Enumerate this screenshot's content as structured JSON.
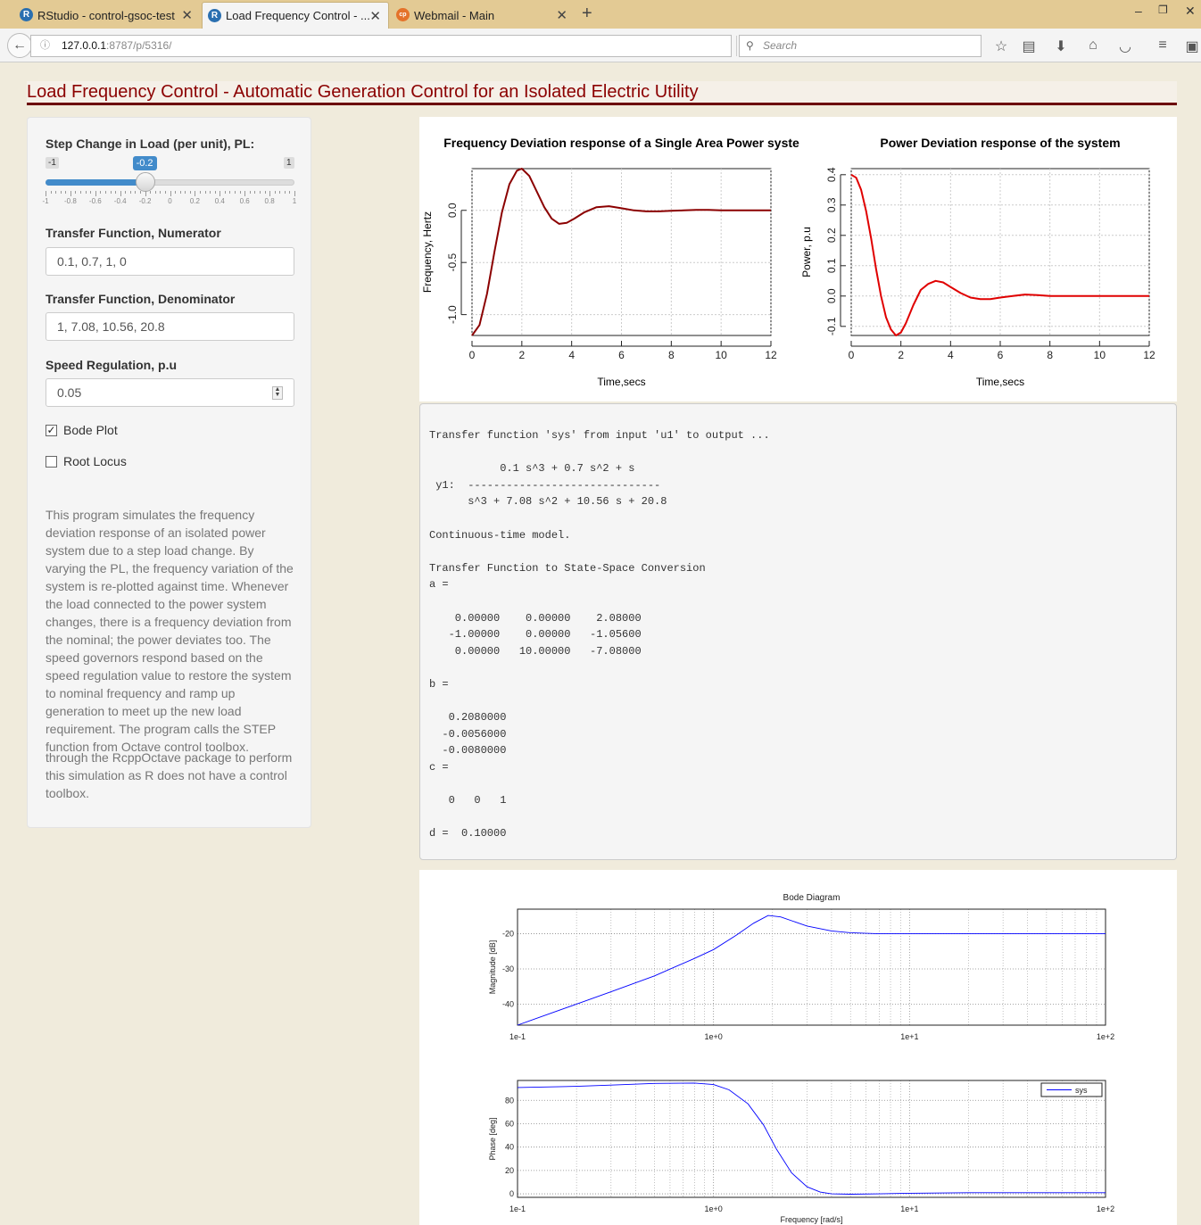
{
  "browser": {
    "tabs": [
      {
        "label": "RStudio - control-gsoc-test",
        "icon": "R",
        "active": false
      },
      {
        "label": "Load Frequency Control - ...",
        "icon": "R",
        "active": true
      },
      {
        "label": "Webmail - Main",
        "icon": "cp",
        "active": false
      }
    ],
    "new_tab_symbol": "+",
    "url_host": "127.0.0.1",
    "url_path": ":8787/p/5316/",
    "search_placeholder": "Search"
  },
  "page_title": "Load Frequency Control - Automatic Generation Control for an Isolated Electric Utility",
  "sidebar": {
    "slider": {
      "label": "Step Change in Load (per unit), PL:",
      "min_label": "-1",
      "max_label": "1",
      "value_label": "-0.2",
      "value": -0.2,
      "min": -1,
      "max": 1,
      "ticks": [
        "-1",
        "-0.8",
        "-0.6",
        "-0.4",
        "-0.2",
        "0",
        "0.2",
        "0.4",
        "0.6",
        "0.8",
        "1"
      ]
    },
    "numerator": {
      "label": "Transfer Function, Numerator",
      "value": "0.1, 0.7, 1, 0"
    },
    "denominator": {
      "label": "Transfer Function, Denominator",
      "value": "1, 7.08, 10.56, 20.8"
    },
    "speed_reg": {
      "label": "Speed Regulation, p.u",
      "value": "0.05"
    },
    "bode": {
      "label": "Bode Plot",
      "checked": true,
      "check_mark": "✓"
    },
    "rlocus": {
      "label": "Root Locus",
      "checked": false
    },
    "description_1": "This program simulates the frequency deviation response of an isolated power system due to a step load change. By varying the PL, the frequency variation of the system is re-plotted against time. Whenever the load connected to the power system changes, there is a frequency deviation from the nominal; the power deviates too. The speed governors respond based on the speed regulation value to restore the system to nominal frequency and ramp up generation to meet up the new load requirement. The program calls the STEP function from Octave control toolbox.",
    "description_2": "through the RcppOctave package to perform this simulation as R does not have a control toolbox."
  },
  "chart_data": [
    {
      "type": "line",
      "title": "Frequency Deviation response of a Single Area Power syste",
      "xlabel": "Time,secs",
      "ylabel": "Frequency, Hertz",
      "xlim": [
        0,
        12
      ],
      "ylim": [
        -1.2,
        0.4
      ],
      "xticks": [
        "0",
        "2",
        "4",
        "6",
        "8",
        "10",
        "12"
      ],
      "yticks": [
        "-1.0",
        "-0.5",
        "0.0"
      ],
      "ytick_values": [
        -1.0,
        -0.5,
        0.0
      ],
      "color": "#8b0000",
      "x": [
        0,
        0.3,
        0.6,
        0.9,
        1.2,
        1.5,
        1.8,
        2.0,
        2.3,
        2.6,
        2.9,
        3.2,
        3.5,
        3.8,
        4.1,
        4.5,
        5.0,
        5.5,
        6.0,
        6.5,
        7.0,
        7.5,
        8.0,
        8.5,
        9.0,
        9.5,
        10.0,
        10.5,
        11.0,
        11.5,
        12.0
      ],
      "y": [
        -1.2,
        -1.1,
        -0.8,
        -0.4,
        -0.02,
        0.25,
        0.38,
        0.4,
        0.33,
        0.18,
        0.03,
        -0.08,
        -0.13,
        -0.12,
        -0.08,
        -0.02,
        0.03,
        0.04,
        0.02,
        0.0,
        -0.01,
        -0.01,
        -0.005,
        0.0,
        0.005,
        0.005,
        0.0,
        0.0,
        0.0,
        0.0,
        0.0
      ],
      "grid": true
    },
    {
      "type": "line",
      "title": "Power Deviation response of the system",
      "xlabel": "Time,secs",
      "ylabel": "Power, p.u",
      "xlim": [
        0,
        12
      ],
      "ylim": [
        -0.13,
        0.42
      ],
      "xticks": [
        "0",
        "2",
        "4",
        "6",
        "8",
        "10",
        "12"
      ],
      "yticks": [
        "-0.1",
        "0.0",
        "0.1",
        "0.2",
        "0.3",
        "0.4"
      ],
      "ytick_values": [
        -0.1,
        0.0,
        0.1,
        0.2,
        0.3,
        0.4
      ],
      "color": "#e00000",
      "x": [
        0,
        0.2,
        0.4,
        0.6,
        0.8,
        1.0,
        1.2,
        1.4,
        1.6,
        1.8,
        2.0,
        2.2,
        2.5,
        2.8,
        3.1,
        3.4,
        3.7,
        4.0,
        4.4,
        4.8,
        5.2,
        5.6,
        6.0,
        6.5,
        7.0,
        7.5,
        8.0,
        9.0,
        10.0,
        11.0,
        12.0
      ],
      "y": [
        0.4,
        0.39,
        0.35,
        0.28,
        0.19,
        0.09,
        0.0,
        -0.07,
        -0.11,
        -0.13,
        -0.12,
        -0.09,
        -0.03,
        0.02,
        0.04,
        0.05,
        0.045,
        0.03,
        0.01,
        -0.005,
        -0.01,
        -0.01,
        -0.005,
        0.0,
        0.005,
        0.003,
        0.0,
        0.0,
        0.0,
        0.0,
        0.0
      ],
      "grid": true
    },
    {
      "type": "line",
      "title": "Bode Diagram",
      "xlabel": "",
      "ylabel": "Magnitude [dB]",
      "xscale": "log",
      "xlim": [
        0.1,
        100
      ],
      "ylim": [
        -46,
        -13
      ],
      "xticks": [
        "1e-1",
        "1e+0",
        "1e+1",
        "1e+2"
      ],
      "yticks": [
        "-20",
        "-30",
        "-40"
      ],
      "ytick_values": [
        -20,
        -30,
        -40
      ],
      "color": "#0000ff",
      "x": [
        0.1,
        0.2,
        0.3,
        0.5,
        0.8,
        1.0,
        1.3,
        1.6,
        1.9,
        2.2,
        2.6,
        3.0,
        4.0,
        5.0,
        7.0,
        10,
        20,
        50,
        100
      ],
      "y": [
        -46,
        -40,
        -36.5,
        -32,
        -27,
        -24.5,
        -20.5,
        -17,
        -14.8,
        -15.2,
        -16.6,
        -17.8,
        -19.2,
        -19.7,
        -20.0,
        -20.0,
        -20.0,
        -20.0,
        -20.0
      ],
      "grid": true
    },
    {
      "type": "line",
      "title": "",
      "xlabel": "Frequency [rad/s]",
      "ylabel": "Phase [deg]",
      "xscale": "log",
      "xlim": [
        0.1,
        100
      ],
      "ylim": [
        -3,
        97
      ],
      "xticks": [
        "1e-1",
        "1e+0",
        "1e+1",
        "1e+2"
      ],
      "yticks": [
        "0",
        "20",
        "40",
        "60",
        "80"
      ],
      "ytick_values": [
        0,
        20,
        40,
        60,
        80
      ],
      "color": "#0000ff",
      "legend": "sys",
      "legend_position": "top-right",
      "x": [
        0.1,
        0.2,
        0.3,
        0.5,
        0.8,
        1.0,
        1.2,
        1.5,
        1.8,
        2.1,
        2.5,
        3.0,
        3.5,
        4.0,
        5.0,
        7.0,
        10,
        20,
        50,
        100
      ],
      "y": [
        91,
        92,
        93,
        94.5,
        94.8,
        93.5,
        89,
        77,
        59,
        38,
        18,
        6,
        1.5,
        0,
        -0.3,
        0,
        0.5,
        1,
        1,
        1
      ],
      "grid": true
    }
  ],
  "output": {
    "lines": [
      "Transfer function 'sys' from input 'u1' to output ...",
      "",
      "           0.1 s^3 + 0.7 s^2 + s",
      " y1:  ------------------------------",
      "      s^3 + 7.08 s^2 + 10.56 s + 20.8",
      "",
      "Continuous-time model.",
      "",
      "Transfer Function to State-Space Conversion",
      "a =",
      "",
      "    0.00000    0.00000    2.08000",
      "   -1.00000    0.00000   -1.05600",
      "    0.00000   10.00000   -7.08000",
      "",
      "b =",
      "",
      "   0.2080000",
      "  -0.0056000",
      "  -0.0080000",
      "c =",
      "",
      "   0   0   1",
      "",
      "d =  0.10000"
    ]
  }
}
